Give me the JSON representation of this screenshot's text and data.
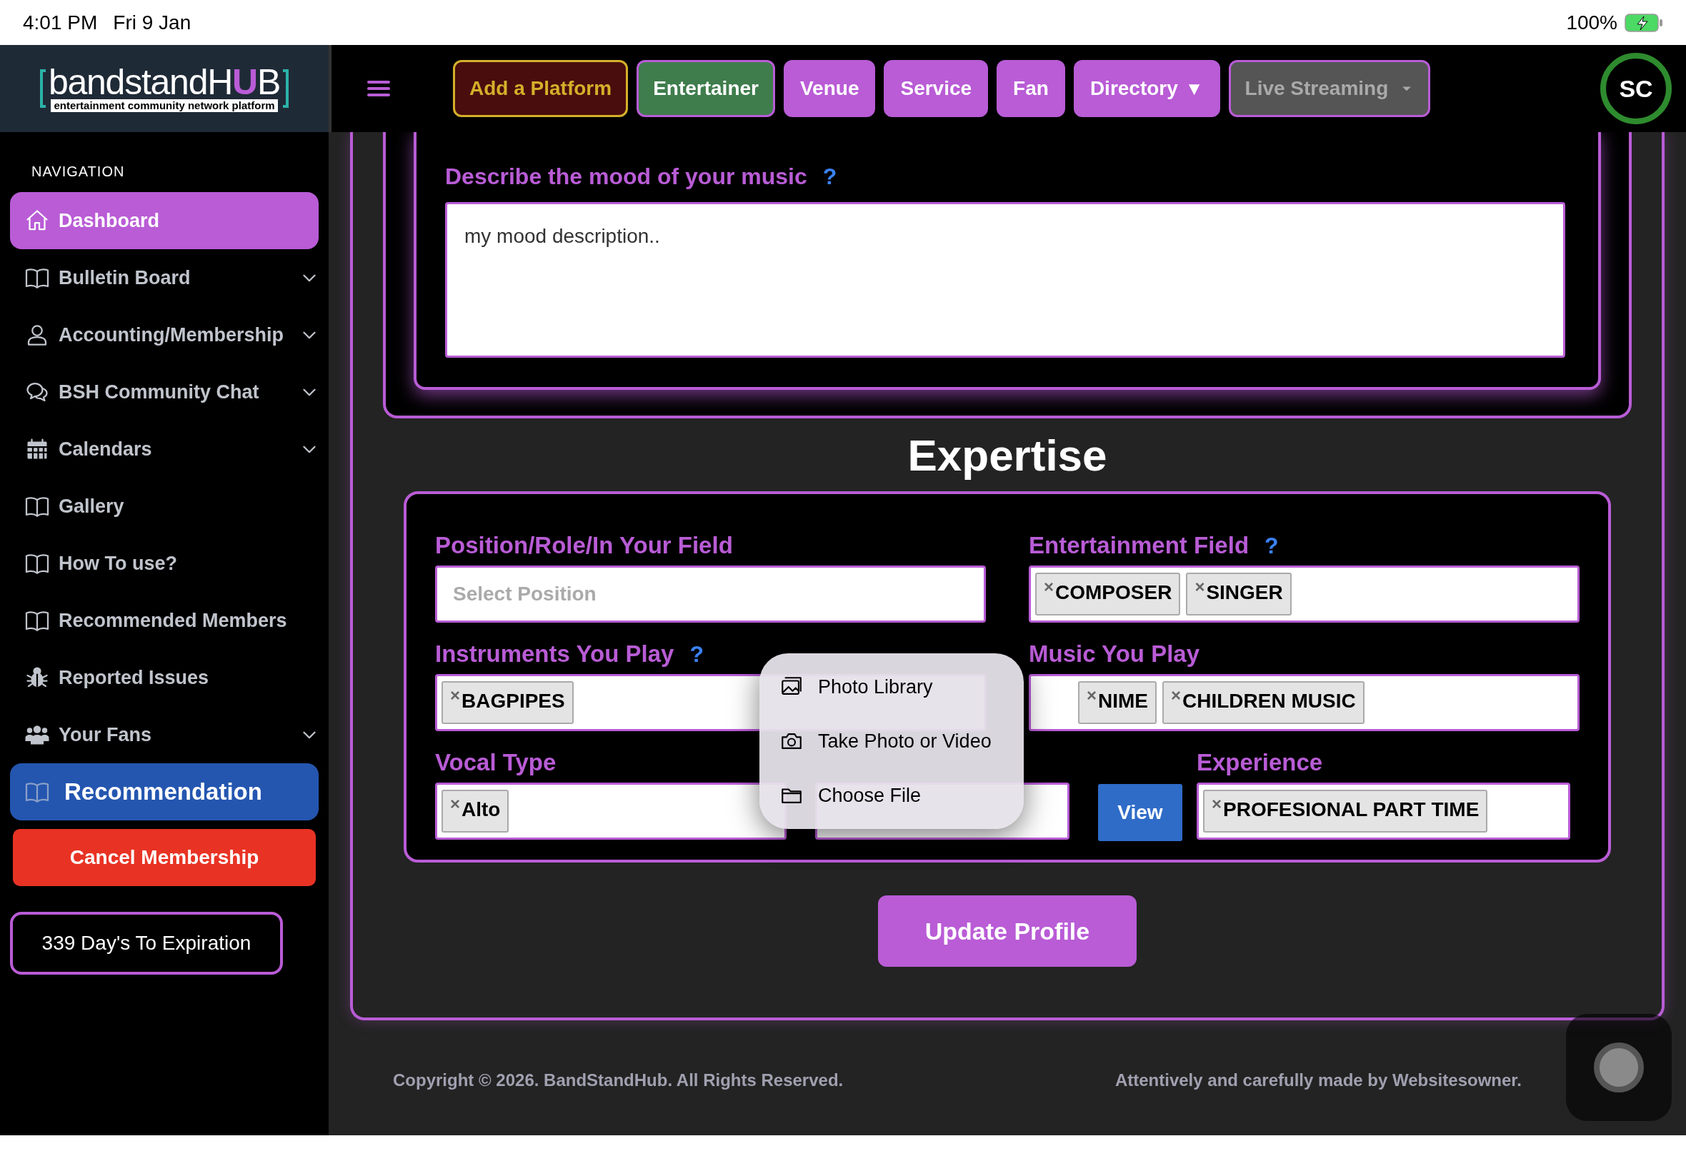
{
  "status_bar": {
    "time": "4:01 PM",
    "date": "Fri 9 Jan",
    "battery": "100%"
  },
  "logo": {
    "parts": [
      {
        "text": "bandstandH",
        "accent": false
      },
      {
        "text": "U",
        "accent": true
      },
      {
        "text": "B",
        "accent": false
      }
    ],
    "tagline": "entertainment community network platform"
  },
  "top_nav": [
    {
      "label": "Add a Platform",
      "kind": "add"
    },
    {
      "label": "Entertainer",
      "kind": "active"
    },
    {
      "label": "Venue",
      "kind": "plain"
    },
    {
      "label": "Service",
      "kind": "plain"
    },
    {
      "label": "Fan",
      "kind": "plain"
    },
    {
      "label": "Directory",
      "kind": "plain",
      "arrow": "▼"
    },
    {
      "label": "Live Streaming",
      "kind": "muted"
    }
  ],
  "avatar": "SC",
  "sidebar": {
    "heading": "NAVIGATION",
    "items": [
      {
        "label": "Dashboard",
        "selected": true,
        "expandable": false
      },
      {
        "label": "Bulletin Board",
        "selected": false,
        "expandable": true
      },
      {
        "label": "Accounting/Membership",
        "selected": false,
        "expandable": true
      },
      {
        "label": "BSH Community Chat",
        "selected": false,
        "expandable": true
      },
      {
        "label": "Calendars",
        "selected": false,
        "expandable": true
      },
      {
        "label": "Gallery",
        "selected": false,
        "expandable": false
      },
      {
        "label": "How To use?",
        "selected": false,
        "expandable": false
      },
      {
        "label": "Recommended Members",
        "selected": false,
        "expandable": false
      },
      {
        "label": "Reported Issues",
        "selected": false,
        "expandable": false
      },
      {
        "label": "Your Fans",
        "selected": false,
        "expandable": true
      }
    ],
    "featured": "Recommendation",
    "cancel": "Cancel Membership",
    "expiry": "339 Day's To Expiration"
  },
  "mood": {
    "label": "Describe the mood of your music",
    "help": "?",
    "value": "my mood description.."
  },
  "expertise": {
    "title": "Expertise",
    "position": {
      "label": "Position/Role/In Your Field",
      "placeholder": "Select Position"
    },
    "entertainment_field": {
      "label": "Entertainment Field",
      "help": "?",
      "tags": [
        "COMPOSER",
        "SINGER"
      ]
    },
    "instruments": {
      "label": "Instruments You Play",
      "help": "?",
      "tags": [
        "BAGPIPES"
      ]
    },
    "music": {
      "label": "Music You Play",
      "tags": [
        "NIME",
        "CHILDREN MUSIC"
      ]
    },
    "vocal_type": {
      "label": "Vocal Type",
      "tags": [
        "Alto"
      ]
    },
    "view_button": "View",
    "experience": {
      "label": "Experience",
      "tags": [
        "PROFESIONAL PART TIME"
      ]
    }
  },
  "tag_remove": "×",
  "update_button": "Update Profile",
  "footer": {
    "copyright": "Copyright © 2026. BandStandHub. All Rights Reserved.",
    "credit": "Attentively and carefully made by Websitesowner."
  },
  "upload_menu": [
    {
      "label": "Photo Library"
    },
    {
      "label": "Take Photo or Video"
    },
    {
      "label": "Choose File"
    }
  ]
}
